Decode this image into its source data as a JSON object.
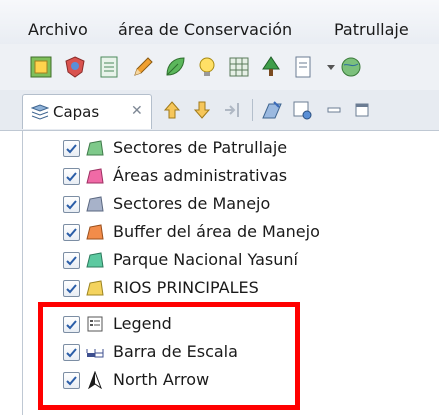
{
  "menubar": {
    "items": [
      "Archivo",
      "área de Conservación",
      "Patrullaje"
    ]
  },
  "toolbar": {
    "buttons": [
      "map-icon",
      "shield-icon",
      "form-icon",
      "pencil-icon",
      "leaf-icon",
      "bulb-icon",
      "grid-icon",
      "tree-icon",
      "document-icon",
      "dropdown-arrow-icon",
      "globe-icon"
    ]
  },
  "view": {
    "tab_label": "Capas",
    "tab_close": "✕",
    "tools": [
      "arrow-up-icon",
      "arrow-down-icon",
      "indent-icon",
      "edit-layer-icon",
      "properties-icon",
      "minimize-icon",
      "maximize-icon"
    ]
  },
  "layers": [
    {
      "name": "Sectores de Patrullaje",
      "checked": true,
      "icon": "polygon-icon",
      "color": "#7ec98a"
    },
    {
      "name": "Áreas administrativas",
      "checked": true,
      "icon": "polygon-icon",
      "color": "#f06aa6"
    },
    {
      "name": "Sectores de Manejo",
      "checked": true,
      "icon": "polygon-icon",
      "color": "#a7b2c9"
    },
    {
      "name": "Buffer del área de Manejo",
      "checked": true,
      "icon": "polygon-icon",
      "color": "#f28c4a"
    },
    {
      "name": "Parque Nacional Yasuní",
      "checked": true,
      "icon": "polygon-icon",
      "color": "#5cc9a0"
    },
    {
      "name": "RIOS PRINCIPALES",
      "checked": true,
      "icon": "polygon-icon",
      "color": "#f4d35e"
    },
    {
      "name": "Legend",
      "checked": true,
      "icon": "legend-icon",
      "color": "#555555"
    },
    {
      "name": "Barra de Escala",
      "checked": true,
      "icon": "scale-bar-icon",
      "color": "#3d4f8f"
    },
    {
      "name": "North Arrow",
      "checked": true,
      "icon": "north-arrow-icon",
      "color": "#1a1a1a"
    }
  ],
  "colors": {
    "highlight": "#ff0000",
    "accent": "#3a6ab8"
  }
}
